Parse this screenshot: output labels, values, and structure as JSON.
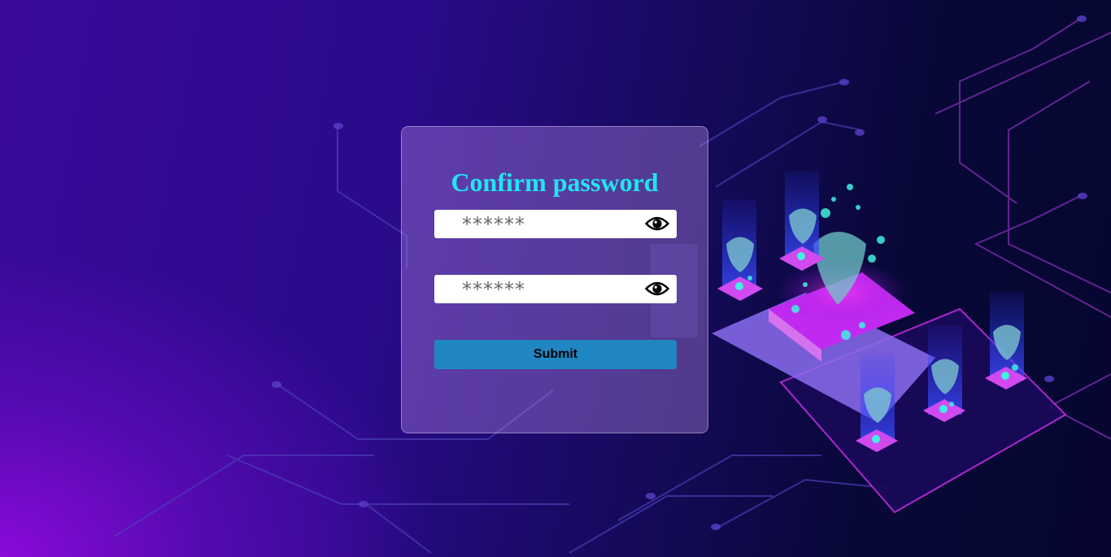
{
  "form": {
    "title": "Confirm password",
    "password_placeholder": "******",
    "confirm_placeholder": "******",
    "submit_label": "Submit"
  },
  "icons": {
    "password_toggle": "eye-icon",
    "confirm_toggle": "eye-icon"
  },
  "colors": {
    "title": "#1fe6f2",
    "submit_bg": "#2086c1",
    "card_bg": "rgba(185,140,235,0.38)"
  }
}
